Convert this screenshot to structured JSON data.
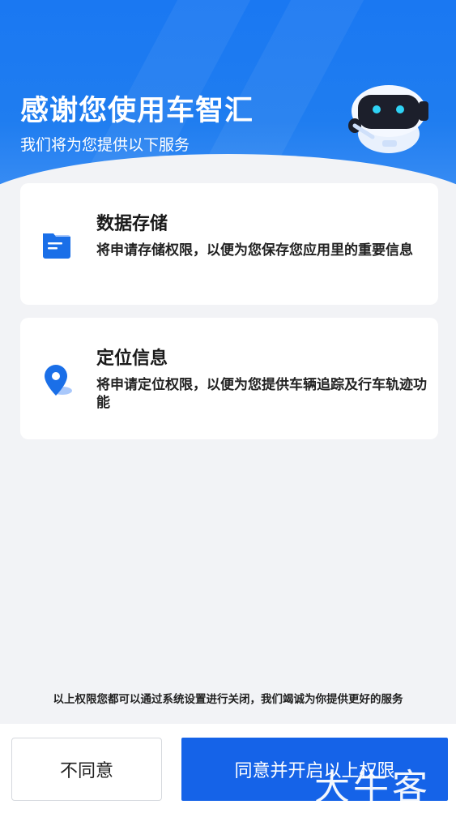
{
  "header": {
    "title": "感谢您使用车智汇",
    "subtitle": "我们将为您提供以下服务",
    "mascot_icon": "robot-mascot-icon"
  },
  "permissions": [
    {
      "icon": "folder-icon",
      "title": "数据存储",
      "description": "将申请存储权限，以便为您保存您应用里的重要信息"
    },
    {
      "icon": "location-pin-icon",
      "title": "定位信息",
      "description": "将申请定位权限，以便为您提供车辆追踪及行车轨迹功能"
    }
  ],
  "footer": {
    "note": "以上权限您都可以通过系统设置进行关闭，我们竭诚为你提供更好的服务",
    "disagree_label": "不同意",
    "agree_label": "同意并开启以上权限"
  },
  "watermark": {
    "text": "大牛客"
  },
  "colors": {
    "primary": "#1563e8",
    "hero": "#1a78f2",
    "background": "#f2f3f6"
  }
}
